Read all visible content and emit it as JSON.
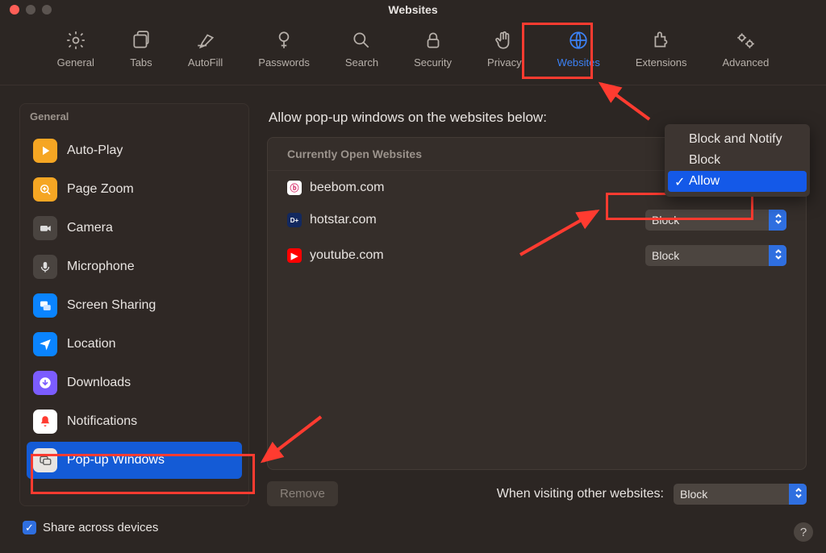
{
  "window": {
    "title": "Websites"
  },
  "toolbar": {
    "items": [
      {
        "label": "General"
      },
      {
        "label": "Tabs"
      },
      {
        "label": "AutoFill"
      },
      {
        "label": "Passwords"
      },
      {
        "label": "Search"
      },
      {
        "label": "Security"
      },
      {
        "label": "Privacy"
      },
      {
        "label": "Websites"
      },
      {
        "label": "Extensions"
      },
      {
        "label": "Advanced"
      }
    ],
    "active_index": 7
  },
  "sidebar": {
    "header": "General",
    "items": [
      {
        "label": "Auto-Play"
      },
      {
        "label": "Page Zoom"
      },
      {
        "label": "Camera"
      },
      {
        "label": "Microphone"
      },
      {
        "label": "Screen Sharing"
      },
      {
        "label": "Location"
      },
      {
        "label": "Downloads"
      },
      {
        "label": "Notifications"
      },
      {
        "label": "Pop-up Windows"
      }
    ],
    "active_index": 8
  },
  "content": {
    "heading": "Allow pop-up windows on the websites below:",
    "list_header": "Currently Open Websites",
    "sites": [
      {
        "domain": "beebom.com",
        "setting": "Allow"
      },
      {
        "domain": "hotstar.com",
        "setting": "Block"
      },
      {
        "domain": "youtube.com",
        "setting": "Block"
      }
    ],
    "remove_label": "Remove",
    "other_label": "When visiting other websites:",
    "other_value": "Block"
  },
  "popup_menu": {
    "options": [
      "Block and Notify",
      "Block",
      "Allow"
    ],
    "selected_index": 2
  },
  "footer": {
    "share_label": "Share across devices"
  }
}
